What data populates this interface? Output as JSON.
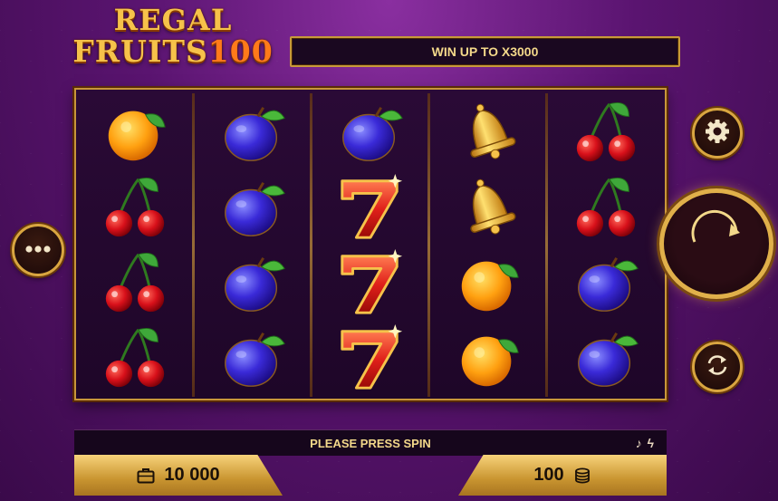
{
  "logo": {
    "line1": "REGAL",
    "line2_word": "FRUITS",
    "line2_num": "100"
  },
  "banner": {
    "win_text": "WIN UP TO X3000"
  },
  "reels": [
    [
      "orange",
      "cherry",
      "cherry",
      "cherry"
    ],
    [
      "plum",
      "plum",
      "plum",
      "plum"
    ],
    [
      "plum",
      "seven",
      "seven",
      "seven"
    ],
    [
      "bell",
      "bell",
      "orange",
      "orange"
    ],
    [
      "cherry",
      "cherry",
      "plum",
      "plum"
    ]
  ],
  "status": {
    "message": "PLEASE PRESS SPIN",
    "icons": [
      "music-note-icon",
      "lightning-icon"
    ]
  },
  "balance": {
    "value": "10 000",
    "icon": "wallet-icon"
  },
  "bet": {
    "value": "100",
    "icon": "coins-icon"
  },
  "controls": {
    "menu_icon": "more-dots-icon",
    "settings_icon": "gear-icon",
    "spin_icon": "spin-arrow-icon",
    "autoplay_icon": "autoplay-icon"
  },
  "colors": {
    "gold": "#d9a640",
    "accent_text": "#f3d88a",
    "background": "#5a1470"
  }
}
